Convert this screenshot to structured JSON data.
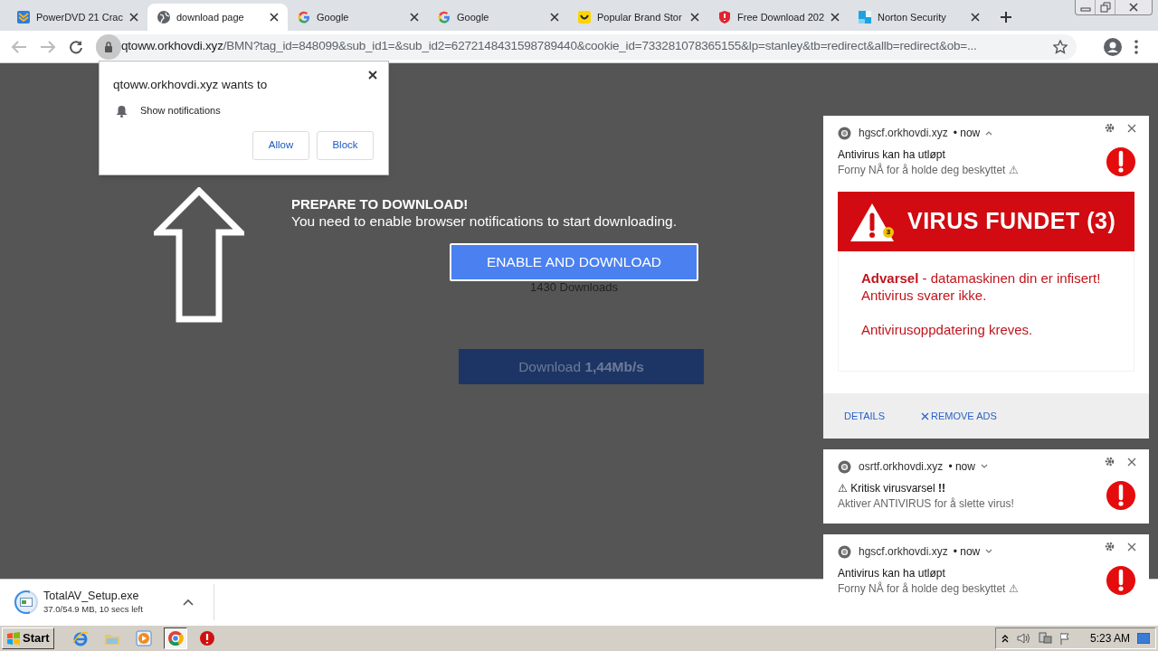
{
  "tabs": [
    {
      "title": "PowerDVD 21 Crac",
      "selected": false
    },
    {
      "title": "download page",
      "selected": true
    },
    {
      "title": "Google",
      "selected": false
    },
    {
      "title": "Google",
      "selected": false
    },
    {
      "title": "Popular Brand Stor",
      "selected": false
    },
    {
      "title": "Free Download 202",
      "selected": false
    },
    {
      "title": "Norton Security",
      "selected": false
    }
  ],
  "address": {
    "host": "qtoww.orkhovdi.xyz",
    "path": "/BMN?tag_id=848099&sub_id1=&sub_id2=6272148431598789440&cookie_id=733281078365155&lp=stanley&tb=redirect&allb=redirect&ob=..."
  },
  "permission_prompt": {
    "title": "qtoww.orkhovdi.xyz wants to",
    "item": "Show notifications",
    "buttons": [
      "Allow",
      "Block"
    ]
  },
  "page": {
    "heading": "PREPARE TO DOWNLOAD!",
    "subheading": "You need to enable browser notifications to start downloading.",
    "primary_button": "ENABLE AND DOWNLOAD",
    "downloads_count": "1430 Downloads",
    "download_button": "Download **1,44Mb/s**"
  },
  "notifications": [
    {
      "site": "hgscf.orkhovdi.xyz",
      "time": "• now",
      "expanded": true,
      "title": "Antivirus kan ha utløpt",
      "body": "Forny NÅ for å holde deg beskyttet ⚠",
      "banner": {
        "title": "VIRUS FUNDET (3)",
        "badge": "3",
        "lines": [
          "**Advarsel** - datamaskinen din er infisert!",
          "Antivirus svarer ikke.",
          "Antivirusoppdatering kreves."
        ]
      },
      "actions": [
        "DETAILS",
        "REMOVE ADS"
      ]
    },
    {
      "site": "osrtf.orkhovdi.xyz",
      "time": "• now",
      "expanded": false,
      "title": "⚠ Kritisk virusvarsel **!!**",
      "body": "Aktiver ANTIVIRUS for å slette virus!"
    },
    {
      "site": "hgscf.orkhovdi.xyz",
      "time": "• now",
      "expanded": false,
      "title": "Antivirus kan ha utløpt",
      "body": "Forny NÅ for å holde deg beskyttet ⚠"
    }
  ],
  "download_item": {
    "filename": "TotalAV_Setup.exe",
    "progress": "37.0/54.9 MB, 10 secs left",
    "level": 0.67
  },
  "taskbar": {
    "start": "Start",
    "apps": [
      {
        "selected": false
      },
      {
        "selected": false
      },
      {
        "selected": false
      },
      {
        "selected": true
      },
      {
        "selected": false
      }
    ],
    "clock": "5:23 AM"
  }
}
